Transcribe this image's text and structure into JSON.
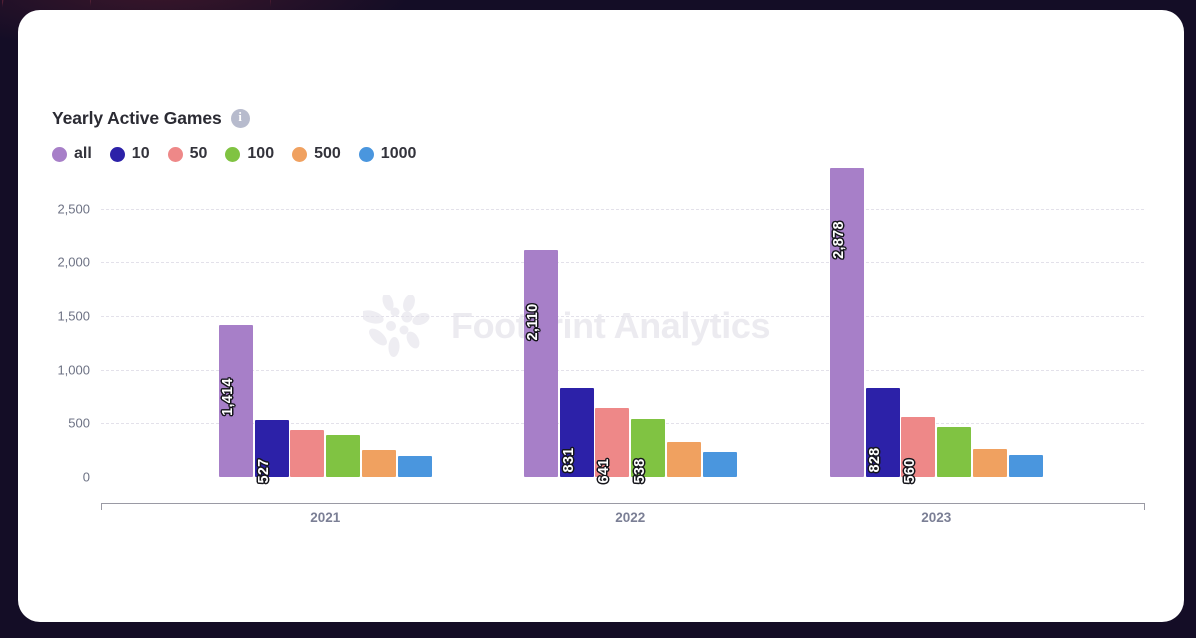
{
  "theme": {
    "backdrop_color": "#140d26",
    "card_color": "#ffffff",
    "grid_color": "#e3e1ea",
    "axis_color": "#9a9aa4",
    "tick_text_color": "#6d7284",
    "x_tick_text_color": "#7b7f95",
    "title_color": "#2b2b33",
    "watermark_color": "#ecebf0"
  },
  "header": {
    "title": "Yearly Active Games",
    "info_icon": "info-icon",
    "info_glyph": "i"
  },
  "watermark": {
    "text": "Footprint Analytics",
    "logo": "sunburst-flower-logo"
  },
  "chart_data": {
    "type": "bar",
    "title": "Yearly Active Games",
    "xlabel": "",
    "ylabel": "",
    "categories": [
      "2021",
      "2022",
      "2023"
    ],
    "ylim": [
      0,
      2878
    ],
    "yticks": [
      0,
      500,
      1000,
      1500,
      2000,
      2500
    ],
    "ytick_labels": [
      "0",
      "500",
      "1,000",
      "1,500",
      "2,000",
      "2,500"
    ],
    "grid": true,
    "legend_position": "top-left",
    "series": [
      {
        "name": "all",
        "color": "#a77fc8",
        "values": [
          1414,
          2110,
          2878
        ],
        "labels": [
          "1,414",
          "2,110",
          "2,878"
        ]
      },
      {
        "name": "10",
        "color": "#2c21a8",
        "values": [
          527,
          831,
          828
        ],
        "labels": [
          "527",
          "831",
          "828"
        ]
      },
      {
        "name": "50",
        "color": "#ee8888",
        "values": [
          435,
          641,
          560
        ],
        "labels": [
          "",
          "641",
          "560"
        ]
      },
      {
        "name": "100",
        "color": "#80c342",
        "values": [
          389,
          538,
          463
        ],
        "labels": [
          "",
          "538",
          ""
        ]
      },
      {
        "name": "500",
        "color": "#f0a160",
        "values": [
          250,
          324,
          259
        ],
        "labels": [
          "",
          "",
          ""
        ]
      },
      {
        "name": "1000",
        "color": "#4a96de",
        "values": [
          194,
          231,
          204
        ],
        "labels": [
          "",
          "",
          ""
        ]
      }
    ]
  }
}
